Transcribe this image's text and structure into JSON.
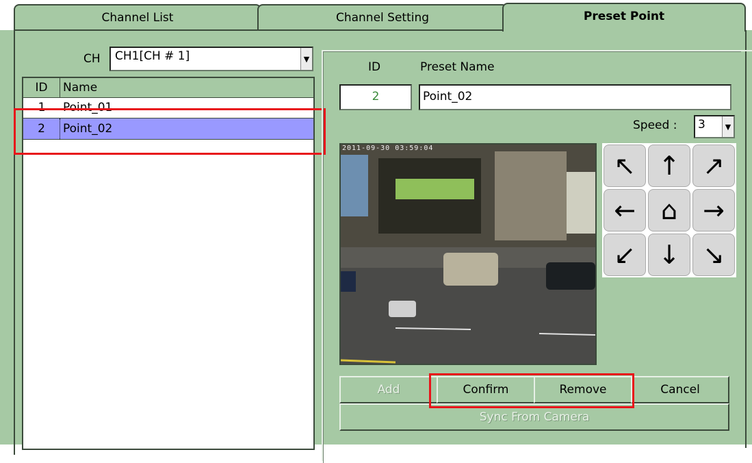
{
  "tabs": [
    {
      "label": "Channel List"
    },
    {
      "label": "Channel Setting"
    },
    {
      "label": "Preset Point"
    }
  ],
  "channel": {
    "label": "CH",
    "selected": "CH1[CH # 1]"
  },
  "list": {
    "headers": {
      "id": "ID",
      "name": "Name"
    },
    "rows": [
      {
        "id": "1",
        "name": "Point_01"
      },
      {
        "id": "2",
        "name": "Point_02"
      }
    ],
    "selected_index": 1
  },
  "editor": {
    "id_label": "ID",
    "name_label": "Preset Name",
    "id_value": "2",
    "name_value": "Point_02",
    "speed_label": "Speed :",
    "speed_value": "3"
  },
  "camera": {
    "timestamp": "2011-09-30 03:59:04"
  },
  "ptz_icons": [
    "arrow-up-left-icon",
    "arrow-up-icon",
    "arrow-up-right-icon",
    "arrow-left-icon",
    "home-icon",
    "arrow-right-icon",
    "arrow-down-left-icon",
    "arrow-down-icon",
    "arrow-down-right-icon"
  ],
  "buttons": {
    "add": "Add",
    "confirm": "Confirm",
    "remove": "Remove",
    "cancel": "Cancel",
    "sync": "Sync From Camera"
  },
  "colors": {
    "panel": "#a6c9a4",
    "selection": "#9999ff",
    "highlight": "#e8141a"
  }
}
